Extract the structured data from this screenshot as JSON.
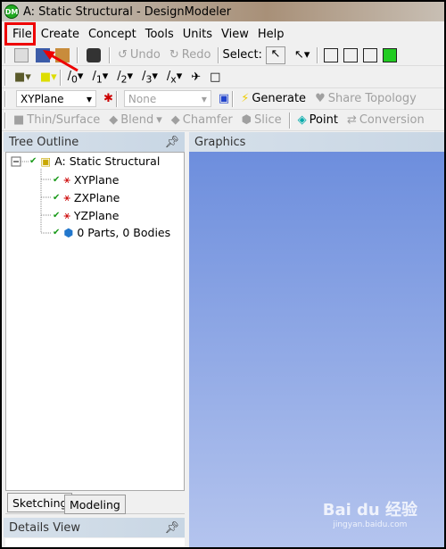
{
  "window": {
    "title": "A: Static Structural - DesignModeler",
    "logo": "DM"
  },
  "menu": [
    "File",
    "Create",
    "Concept",
    "Tools",
    "Units",
    "View",
    "Help"
  ],
  "toolbar1": {
    "undo": "Undo",
    "redo": "Redo",
    "select": "Select:"
  },
  "toolbar2": {
    "plane_labels": [
      "0",
      "1",
      "2",
      "3",
      "x"
    ]
  },
  "toolbar3": {
    "plane_value": "XYPlane",
    "sketch_value": "None",
    "generate": "Generate",
    "share_topology": "Share Topology"
  },
  "toolbar4": {
    "thin_surface": "Thin/Surface",
    "blend": "Blend",
    "chamfer": "Chamfer",
    "slice": "Slice",
    "point": "Point",
    "conversion": "Conversion"
  },
  "tree": {
    "header": "Tree Outline",
    "root": "A: Static Structural",
    "items": [
      "XYPlane",
      "ZXPlane",
      "YZPlane",
      "0 Parts, 0 Bodies"
    ]
  },
  "graphics": {
    "header": "Graphics"
  },
  "tabs": [
    "Sketching",
    "Modeling"
  ],
  "details": {
    "header": "Details View"
  },
  "watermark": {
    "brand": "Bai du 经验",
    "url": "jingyan.baidu.com"
  },
  "colors": {
    "highlight": "#e00000",
    "graphics_top": "#6d8edd",
    "graphics_bottom": "#b4c4ee"
  }
}
